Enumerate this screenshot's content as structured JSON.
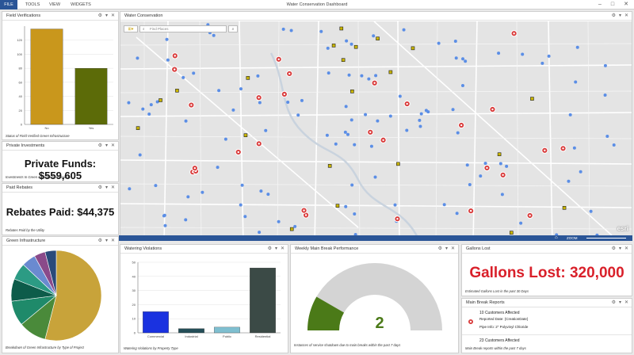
{
  "app": {
    "title": "Water Conservation Dashboard",
    "menus": [
      "FILE",
      "TOOLS",
      "VIEW",
      "WIDGETS"
    ],
    "accent": "#2a5597"
  },
  "window": {
    "minimize": "–",
    "maximize": "□",
    "close": "✕"
  },
  "panel_tools": {
    "gear": "⚙",
    "dropdown": "▾",
    "close": "✕"
  },
  "field": {
    "title": "Field Verifications",
    "caption": "Status of Field Verified Green Infrastructure",
    "chart_data": {
      "type": "bar",
      "categories": [
        "No",
        "Yes"
      ],
      "values": [
        136,
        80
      ],
      "ylim": [
        0,
        140
      ],
      "yticks": [
        0,
        20,
        40,
        60,
        80,
        100,
        120
      ],
      "colors": [
        "#c9971c",
        "#5c6b08"
      ]
    }
  },
  "private": {
    "title": "Private Investments",
    "value": "Private Funds: $559,605",
    "caption": "Investments In Green Infrastructure Projects"
  },
  "rebates": {
    "title": "Paid Rebates",
    "value": "Rebates Paid: $44,375",
    "caption": "Rebates Paid by the Utility"
  },
  "green": {
    "title": "Green Infrastructure",
    "caption": "Breakdown of Green Infrastructure by Type of Project",
    "chart_data": {
      "type": "pie",
      "values": [
        54,
        10,
        9,
        8,
        6,
        5,
        4,
        4
      ],
      "colors": [
        "#c8a33a",
        "#4a8a3a",
        "#1f8a6a",
        "#0d5c4a",
        "#2c9b84",
        "#6a8ad0",
        "#8a4a8a",
        "#2a4a7a"
      ]
    }
  },
  "map": {
    "title": "Water Conservation",
    "search_placeholder": "Find Places",
    "zoom_label": "ZOOM",
    "home_icon": "⌂",
    "logo": "esri",
    "water_color": "#c9d3de",
    "point_color": "#5b8ee6",
    "break_color": "#d93b3b",
    "square_color": "#c8b400"
  },
  "violations": {
    "title": "Watering Violations",
    "caption": "Watering Violations by Property Type",
    "chart_data": {
      "type": "bar",
      "categories": [
        "Commercial",
        "Industrial",
        "Public",
        "Residential"
      ],
      "values": [
        15,
        3,
        4,
        46
      ],
      "ylim": [
        0,
        50
      ],
      "yticks": [
        0,
        10,
        20,
        30,
        40,
        50
      ],
      "colors": [
        "#1a32e0",
        "#244e58",
        "#7fbfd0",
        "#3b4a46"
      ]
    }
  },
  "weekly": {
    "title": "Weekly Main Break Performance",
    "value": "2",
    "caption": "Instances of service shutdown due to main breaks within the past 7 days",
    "gauge": {
      "value": 2,
      "min": 0,
      "max": 12,
      "fill": "#4b7a18",
      "track": "#d4d4d4"
    }
  },
  "gallons": {
    "title": "Gallons Lost",
    "value": "Gallons Lost: 320,000",
    "caption": "Estimated Gallons Lost in the past 30 Days",
    "color": "#d9202a"
  },
  "reports": {
    "title": "Main Break Reports",
    "caption": "Main Break reports within the past 7 days",
    "items": [
      {
        "title": "10 Customers Affected",
        "line1": "Reported Date: {CreationDate}",
        "line2": "Pipe Info: 2\" Polyvinyl Chloride"
      },
      {
        "title": "23 Customers Affected"
      }
    ]
  }
}
